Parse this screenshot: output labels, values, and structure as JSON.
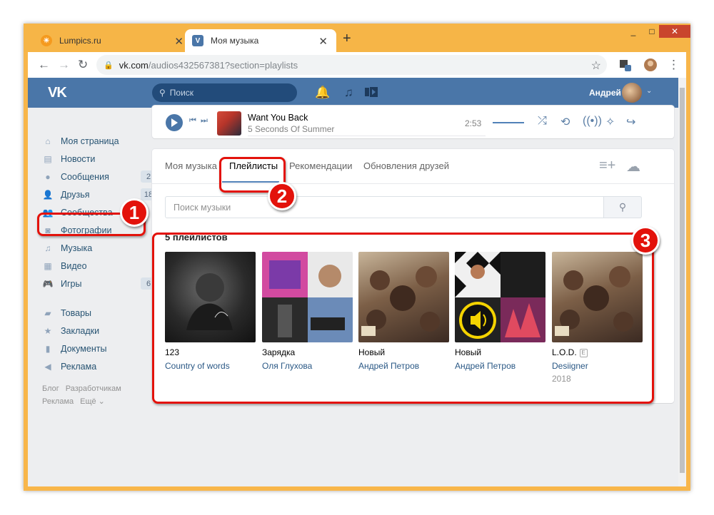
{
  "browser": {
    "tabs": [
      {
        "title": "Lumpics.ru",
        "active": false
      },
      {
        "title": "Моя музыка",
        "active": true
      }
    ],
    "url_host": "vk.com",
    "url_path": "/audios432567381?section=playlists",
    "window_buttons": [
      "_",
      "□",
      "✕"
    ]
  },
  "header": {
    "logo": "VK",
    "search_placeholder": "Поиск",
    "user_name": "Андрей"
  },
  "sidebar": {
    "items": [
      {
        "label": "Моя страница",
        "icon": "home-icon"
      },
      {
        "label": "Новости",
        "icon": "news-icon"
      },
      {
        "label": "Сообщения",
        "icon": "messages-icon",
        "count": "2"
      },
      {
        "label": "Друзья",
        "icon": "friends-icon",
        "count": "18"
      },
      {
        "label": "Сообщества",
        "icon": "communities-icon"
      },
      {
        "label": "Фотографии",
        "icon": "camera-icon"
      },
      {
        "label": "Музыка",
        "icon": "music-icon"
      },
      {
        "label": "Видео",
        "icon": "video-icon"
      },
      {
        "label": "Игры",
        "icon": "games-icon",
        "count": "6"
      }
    ],
    "items2": [
      {
        "label": "Товары",
        "icon": "bag-icon"
      },
      {
        "label": "Закладки",
        "icon": "star-icon"
      },
      {
        "label": "Документы",
        "icon": "document-icon"
      },
      {
        "label": "Реклама",
        "icon": "ads-icon"
      }
    ],
    "footer": [
      "Блог",
      "Разработчикам",
      "Реклама",
      "Ещё"
    ]
  },
  "player": {
    "title": "Want You Back",
    "artist": "5 Seconds Of Summer",
    "time": "2:53"
  },
  "music": {
    "tabs": [
      "Моя музыка",
      "Плейлисты",
      "Рекомендации",
      "Обновления друзей"
    ],
    "search_placeholder": "Поиск музыки",
    "playlists_count_label": "5 плейлистов",
    "playlists": [
      {
        "name": "123",
        "author": "Country of words",
        "year": ""
      },
      {
        "name": "Зарядка",
        "author": "Оля Глухова",
        "year": ""
      },
      {
        "name": "Новый",
        "author": "Андрей Петров",
        "year": ""
      },
      {
        "name": "Новый",
        "author": "Андрей Петров",
        "year": ""
      },
      {
        "name": "L.O.D.",
        "author": "Desiigner",
        "year": "2018",
        "explicit": "E"
      }
    ]
  },
  "annotations": {
    "markers": [
      "1",
      "2",
      "3"
    ]
  },
  "colors": {
    "vk_blue": "#4a76a8",
    "link": "#2a5885",
    "annotation_red": "#e3120b",
    "browser_frame": "#f6b547"
  }
}
